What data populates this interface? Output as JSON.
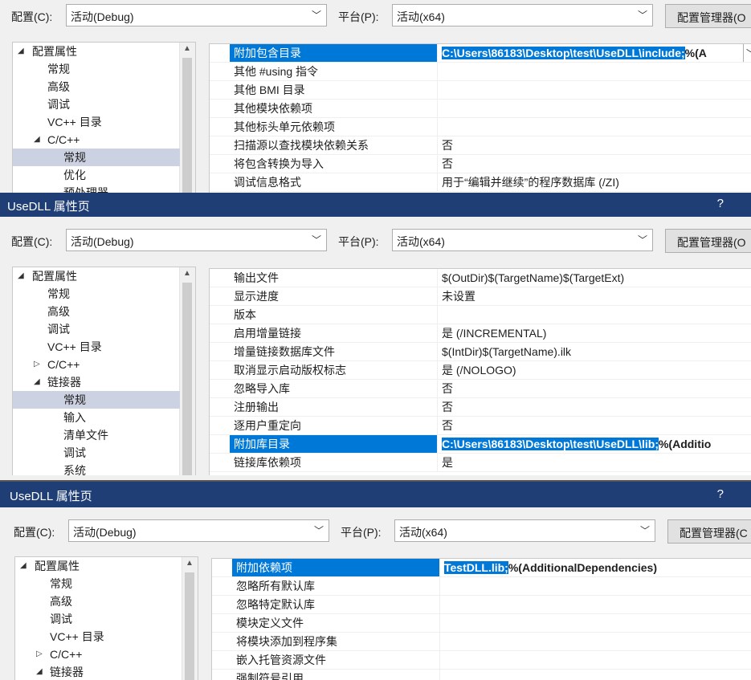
{
  "panel1": {
    "config_label": "配置(C):",
    "config_value": "活动(Debug)",
    "platform_label": "平台(P):",
    "platform_value": "活动(x64)",
    "manager_button": "配置管理器(O",
    "tree": [
      {
        "label": "配置属性",
        "indent": 0,
        "expander": "◢"
      },
      {
        "label": "常规",
        "indent": 1,
        "expander": ""
      },
      {
        "label": "高级",
        "indent": 1,
        "expander": ""
      },
      {
        "label": "调试",
        "indent": 1,
        "expander": ""
      },
      {
        "label": "VC++ 目录",
        "indent": 1,
        "expander": ""
      },
      {
        "label": "C/C++",
        "indent": 1,
        "expander": "◢"
      },
      {
        "label": "常规",
        "indent": 2,
        "expander": "",
        "selected": true
      },
      {
        "label": "优化",
        "indent": 2,
        "expander": ""
      },
      {
        "label": "预处理器",
        "indent": 2,
        "expander": ""
      }
    ],
    "props": [
      {
        "name": "附加包含目录",
        "value_hl": "C:\\Users\\86183\\Desktop\\test\\UseDLL\\include;",
        "value_rest": "%(A",
        "selected": true
      },
      {
        "name": "其他 #using 指令",
        "value": ""
      },
      {
        "name": "其他 BMI 目录",
        "value": ""
      },
      {
        "name": "其他模块依赖项",
        "value": ""
      },
      {
        "name": "其他标头单元依赖项",
        "value": ""
      },
      {
        "name": "扫描源以查找模块依赖关系",
        "value": "否"
      },
      {
        "name": "将包含转换为导入",
        "value": "否"
      },
      {
        "name": "调试信息格式",
        "value": "用于“编辑并继续”的程序数据库 (/ZI)"
      }
    ]
  },
  "panel2": {
    "title": "UseDLL 属性页",
    "help": "?",
    "config_label": "配置(C):",
    "config_value": "活动(Debug)",
    "platform_label": "平台(P):",
    "platform_value": "活动(x64)",
    "manager_button": "配置管理器(O",
    "tree": [
      {
        "label": "配置属性",
        "indent": 0,
        "expander": "◢"
      },
      {
        "label": "常规",
        "indent": 1,
        "expander": ""
      },
      {
        "label": "高级",
        "indent": 1,
        "expander": ""
      },
      {
        "label": "调试",
        "indent": 1,
        "expander": ""
      },
      {
        "label": "VC++ 目录",
        "indent": 1,
        "expander": ""
      },
      {
        "label": "C/C++",
        "indent": 1,
        "expander": "▷"
      },
      {
        "label": "链接器",
        "indent": 1,
        "expander": "◢"
      },
      {
        "label": "常规",
        "indent": 2,
        "expander": "",
        "selected": true
      },
      {
        "label": "输入",
        "indent": 2,
        "expander": ""
      },
      {
        "label": "清单文件",
        "indent": 2,
        "expander": ""
      },
      {
        "label": "调试",
        "indent": 2,
        "expander": ""
      },
      {
        "label": "系统",
        "indent": 2,
        "expander": ""
      }
    ],
    "props": [
      {
        "name": "输出文件",
        "value": "$(OutDir)$(TargetName)$(TargetExt)"
      },
      {
        "name": "显示进度",
        "value": "未设置"
      },
      {
        "name": "版本",
        "value": ""
      },
      {
        "name": "启用增量链接",
        "value": "是 (/INCREMENTAL)"
      },
      {
        "name": "增量链接数据库文件",
        "value": "$(IntDir)$(TargetName).ilk"
      },
      {
        "name": "取消显示启动版权标志",
        "value": "是 (/NOLOGO)"
      },
      {
        "name": "忽略导入库",
        "value": "否"
      },
      {
        "name": "注册输出",
        "value": "否"
      },
      {
        "name": "逐用户重定向",
        "value": "否"
      },
      {
        "name": "附加库目录",
        "value_hl": "C:\\Users\\86183\\Desktop\\test\\UseDLL\\lib;",
        "value_rest": "%(Additio",
        "selected": true
      },
      {
        "name": "链接库依赖项",
        "value": "是"
      }
    ]
  },
  "panel3": {
    "title": "UseDLL 属性页",
    "help": "?",
    "config_label": "配置(C):",
    "config_value": "活动(Debug)",
    "platform_label": "平台(P):",
    "platform_value": "活动(x64)",
    "manager_button": "配置管理器(C",
    "tree": [
      {
        "label": "配置属性",
        "indent": 0,
        "expander": "◢"
      },
      {
        "label": "常规",
        "indent": 1,
        "expander": ""
      },
      {
        "label": "高级",
        "indent": 1,
        "expander": ""
      },
      {
        "label": "调试",
        "indent": 1,
        "expander": ""
      },
      {
        "label": "VC++ 目录",
        "indent": 1,
        "expander": ""
      },
      {
        "label": "C/C++",
        "indent": 1,
        "expander": "▷"
      },
      {
        "label": "链接器",
        "indent": 1,
        "expander": "◢"
      }
    ],
    "props": [
      {
        "name": "附加依赖项",
        "value_hl": "TestDLL.lib;",
        "value_rest": "%(AdditionalDependencies)",
        "selected": true
      },
      {
        "name": "忽略所有默认库",
        "value": ""
      },
      {
        "name": "忽略特定默认库",
        "value": ""
      },
      {
        "name": "模块定义文件",
        "value": ""
      },
      {
        "name": "将模块添加到程序集",
        "value": ""
      },
      {
        "name": "嵌入托管资源文件",
        "value": ""
      },
      {
        "name": "强制符号引用",
        "value": ""
      }
    ]
  },
  "colors": {
    "titlebar": "#1f3e75",
    "selection": "#0078d7",
    "tree_selection": "#cdd2e2"
  }
}
